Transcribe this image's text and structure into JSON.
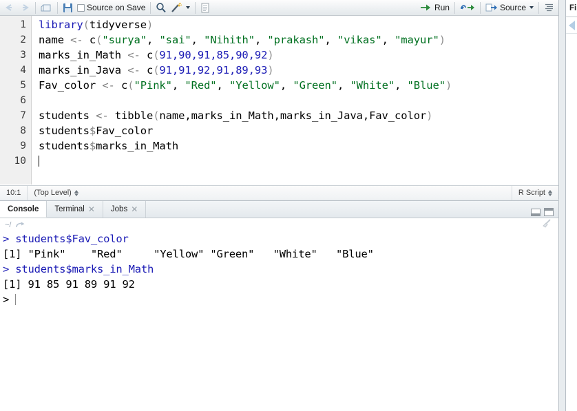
{
  "source": {
    "toolbar": {
      "back_icon": "back-arrow-icon",
      "forward_icon": "forward-arrow-icon",
      "show_doc_icon": "show-in-new-window-icon",
      "save_icon": "save-icon",
      "source_on_save_label": "Source on Save",
      "find_icon": "search-icon",
      "wand_icon": "code-tools-wand-icon",
      "compile_report_icon": "compile-report-icon",
      "run_label": "Run",
      "rerun_icon": "rerun-previous-icon",
      "source_label": "Source",
      "outline_icon": "document-outline-icon"
    },
    "lines": [
      {
        "n": "1",
        "tokens": [
          {
            "t": "library",
            "c": "fn"
          },
          {
            "t": "(",
            "c": "punc"
          },
          {
            "t": "tidyverse",
            "c": "plain"
          },
          {
            "t": ")",
            "c": "punc"
          }
        ]
      },
      {
        "n": "2",
        "tokens": [
          {
            "t": "name ",
            "c": "plain"
          },
          {
            "t": "<-",
            "c": "op"
          },
          {
            "t": " c",
            "c": "plain"
          },
          {
            "t": "(",
            "c": "punc"
          },
          {
            "t": "\"surya\"",
            "c": "str"
          },
          {
            "t": ", ",
            "c": "plain"
          },
          {
            "t": "\"sai\"",
            "c": "str"
          },
          {
            "t": ", ",
            "c": "plain"
          },
          {
            "t": "\"Nihith\"",
            "c": "str"
          },
          {
            "t": ", ",
            "c": "plain"
          },
          {
            "t": "\"prakash\"",
            "c": "str"
          },
          {
            "t": ", ",
            "c": "plain"
          },
          {
            "t": "\"vikas\"",
            "c": "str"
          },
          {
            "t": ", ",
            "c": "plain"
          },
          {
            "t": "\"mayur\"",
            "c": "str"
          },
          {
            "t": ")",
            "c": "punc"
          }
        ]
      },
      {
        "n": "3",
        "tokens": [
          {
            "t": "marks_in_Math ",
            "c": "plain"
          },
          {
            "t": "<-",
            "c": "op"
          },
          {
            "t": " c",
            "c": "plain"
          },
          {
            "t": "(",
            "c": "punc"
          },
          {
            "t": "91,90,91,85,90,92",
            "c": "num"
          },
          {
            "t": ")",
            "c": "punc"
          }
        ]
      },
      {
        "n": "4",
        "tokens": [
          {
            "t": "marks_in_Java ",
            "c": "plain"
          },
          {
            "t": "<-",
            "c": "op"
          },
          {
            "t": " c",
            "c": "plain"
          },
          {
            "t": "(",
            "c": "punc"
          },
          {
            "t": "91,91,92,91,89,93",
            "c": "num"
          },
          {
            "t": ")",
            "c": "punc"
          }
        ]
      },
      {
        "n": "5",
        "tokens": [
          {
            "t": "Fav_color ",
            "c": "plain"
          },
          {
            "t": "<-",
            "c": "op"
          },
          {
            "t": " c",
            "c": "plain"
          },
          {
            "t": "(",
            "c": "punc"
          },
          {
            "t": "\"Pink\"",
            "c": "str"
          },
          {
            "t": ", ",
            "c": "plain"
          },
          {
            "t": "\"Red\"",
            "c": "str"
          },
          {
            "t": ", ",
            "c": "plain"
          },
          {
            "t": "\"Yellow\"",
            "c": "str"
          },
          {
            "t": ", ",
            "c": "plain"
          },
          {
            "t": "\"Green\"",
            "c": "str"
          },
          {
            "t": ", ",
            "c": "plain"
          },
          {
            "t": "\"White\"",
            "c": "str"
          },
          {
            "t": ", ",
            "c": "plain"
          },
          {
            "t": "\"Blue\"",
            "c": "str"
          },
          {
            "t": ")",
            "c": "punc"
          }
        ]
      },
      {
        "n": "6",
        "tokens": []
      },
      {
        "n": "7",
        "tokens": [
          {
            "t": "students ",
            "c": "plain"
          },
          {
            "t": "<-",
            "c": "op"
          },
          {
            "t": " tibble",
            "c": "plain"
          },
          {
            "t": "(",
            "c": "punc"
          },
          {
            "t": "name,marks_in_Math,marks_in_Java,Fav_color",
            "c": "plain"
          },
          {
            "t": ")",
            "c": "punc"
          }
        ]
      },
      {
        "n": "8",
        "tokens": [
          {
            "t": "students",
            "c": "plain"
          },
          {
            "t": "$",
            "c": "dollar"
          },
          {
            "t": "Fav_color",
            "c": "plain"
          }
        ]
      },
      {
        "n": "9",
        "tokens": [
          {
            "t": "students",
            "c": "plain"
          },
          {
            "t": "$",
            "c": "dollar"
          },
          {
            "t": "marks_in_Math",
            "c": "plain"
          }
        ]
      },
      {
        "n": "10",
        "tokens": [],
        "cursor": true
      }
    ],
    "status": {
      "position": "10:1",
      "scope": "(Top Level)",
      "file_type": "R Script"
    }
  },
  "console": {
    "tabs": [
      {
        "label": "Console",
        "active": true,
        "closable": false
      },
      {
        "label": "Terminal",
        "active": false,
        "closable": true
      },
      {
        "label": "Jobs",
        "active": false,
        "closable": true
      }
    ],
    "close_glyph": "✕",
    "minimize_icon": "minimize-pane-icon",
    "maximize_icon": "maximize-pane-icon",
    "working_directory": "~/",
    "open_in_window_icon": "open-in-window-icon",
    "clear_console_icon": "broom-clear-icon",
    "output": [
      {
        "text": "> students$Fav_color",
        "style": "cmd"
      },
      {
        "text": "[1] \"Pink\"    \"Red\"     \"Yellow\" \"Green\"   \"White\"   \"Blue\"",
        "style": "out"
      },
      {
        "text": "> students$marks_in_Math",
        "style": "cmd"
      },
      {
        "text": "[1] 91 85 91 89 91 92",
        "style": "out"
      },
      {
        "text": "> ",
        "style": "prompt",
        "cursor": true
      }
    ]
  },
  "right_pane": {
    "tab_label": "Fi",
    "back_icon": "back-navigation-icon"
  },
  "colors": {
    "keyword": "#1b1bb5",
    "string": "#007020",
    "number": "#1b1bb5",
    "punctuation": "#909090",
    "console_command": "#1b1bb5",
    "gutter_bg": "#f0f0f0"
  }
}
